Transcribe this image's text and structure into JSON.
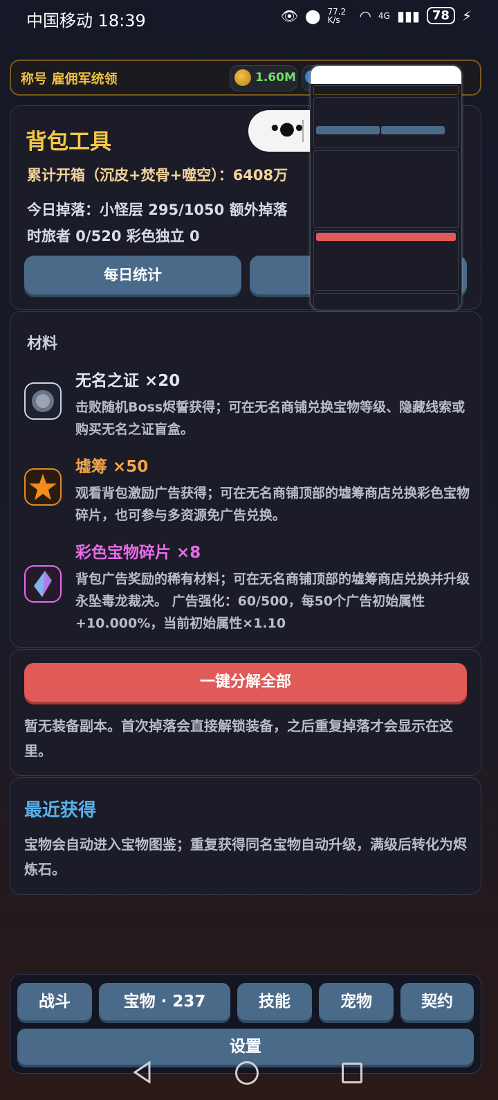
{
  "status_bar": {
    "carrier_time": "中国移动 18:39",
    "net_speed": "77.2 K/s",
    "network": "4G",
    "battery": "78"
  },
  "header": {
    "title_label": "称号 雇佣军统领",
    "coins": "1.60M"
  },
  "bag": {
    "title": "背包工具",
    "total_boxes": "累计开箱（沉皮+焚骨+噬空）：6408万",
    "today_drops": "今日掉落：小怪层 295/1050  额外掉落",
    "time_travel": "时旅者 0/520  彩色独立 0",
    "daily_stats_button": "每日统计"
  },
  "materials": {
    "title": "材料",
    "items": [
      {
        "name": "无名之证 ×20",
        "desc": "击败随机Boss烬誓获得；可在无名商铺兑换宝物等级、隐藏线索或购买无名之证盲盒。",
        "color": "#dfe7f5"
      },
      {
        "name": "墟筹 ×50",
        "desc": "观看背包激励广告获得；可在无名商铺顶部的墟筹商店兑换彩色宝物碎片，也可参与多资源免广告兑换。",
        "color": "#f5a64a"
      },
      {
        "name": "彩色宝物碎片 ×8",
        "desc": "背包广告奖励的稀有材料；可在无名商铺顶部的墟筹商店兑换并升级永坠毒龙裁决。 广告强化：60/500，每50个广告初始属性+10.000%，当前初始属性×1.10",
        "color": "#e86be8"
      }
    ]
  },
  "decompose": {
    "button": "一键分解全部",
    "note": "暂无装备副本。首次掉落会直接解锁装备，之后重复掉落才会显示在这里。"
  },
  "recent": {
    "title": "最近获得",
    "note": "宝物会自动进入宝物图鉴；重复获得同名宝物自动升级，满级后转化为烬炼石。"
  },
  "tabs": {
    "battle": "战斗",
    "treasure": "宝物 · 237",
    "skills": "技能",
    "pets": "宠物",
    "contract": "契约",
    "settings": "设置"
  }
}
